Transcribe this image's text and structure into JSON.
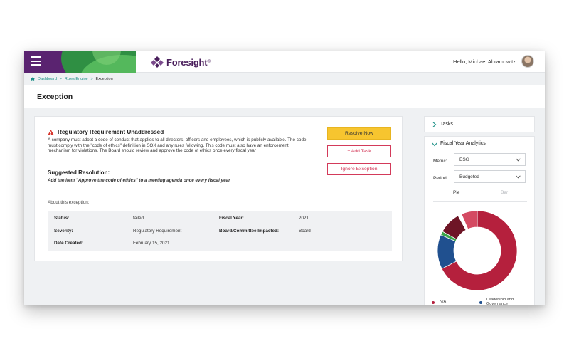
{
  "header": {
    "brand": "Foresight",
    "brand_mark": "®",
    "greeting": "Hello, Michael Abramowitz"
  },
  "breadcrumb": {
    "items": [
      "Dashboard",
      "Rules Engine",
      "Exception"
    ],
    "separator": ">"
  },
  "page": {
    "title": "Exception"
  },
  "exception": {
    "title": "Regulatory Requirement Unaddressed",
    "description": "A company must adopt a code of conduct that applies to all directors, officers and employees, which is publicly available. The code must comply with the \"code of ethics\" definition in SOX and any rules following. This code must also have an enforcement mechanism for violations. The Board should review and approve the code of ethics once every fiscal year",
    "suggested_title": "Suggested Resolution:",
    "suggested_text": "Add the item \"Approve the code of ethics\" to a meeting agenda once every fiscal year",
    "about_label": "About this exception:"
  },
  "actions": {
    "resolve": "Resolve Now",
    "add_task": "+ Add Task",
    "ignore": "Ignore Exception"
  },
  "details": {
    "status_label": "Status:",
    "status_value": "failed",
    "severity_label": "Severity:",
    "severity_value": "Regulatory Requirement",
    "date_label": "Date Created:",
    "date_value": "February 15, 2021",
    "fiscal_label": "Fiscal Year:",
    "fiscal_value": "2021",
    "board_label": "Board/Committee Impacted:",
    "board_value": "Board"
  },
  "side": {
    "tasks_label": "Tasks",
    "analytics_label": "Fiscal Year Analytics",
    "metric_label": "Metric:",
    "metric_value": "ESG",
    "period_label": "Period:",
    "period_value": "Budgeted",
    "tab_pie": "Pie",
    "tab_bar": "Bar",
    "legend": [
      {
        "label": "N/A",
        "color": "#b5203d"
      },
      {
        "label": "Leadership and Governance",
        "color": "#20508f"
      }
    ]
  },
  "chart_data": {
    "type": "pie",
    "donut": true,
    "slices": [
      {
        "value": 67.5,
        "color": "#b5203d"
      },
      {
        "value": 14.0,
        "color": "#20508f"
      },
      {
        "value": 1.5,
        "color": "#3aa64a"
      },
      {
        "value": 9.0,
        "color": "#6e1526"
      },
      {
        "value": 1.5,
        "color": "#ffffff"
      },
      {
        "value": 6.5,
        "color": "#d44a62"
      }
    ],
    "start_angle_deg": 0,
    "legend_position": "bottom"
  },
  "colors": {
    "accent": "#1a8f86",
    "brand_purple": "#4a1f5c",
    "resolve_yellow": "#f7c52f",
    "danger_pink": "#d33a5a"
  }
}
